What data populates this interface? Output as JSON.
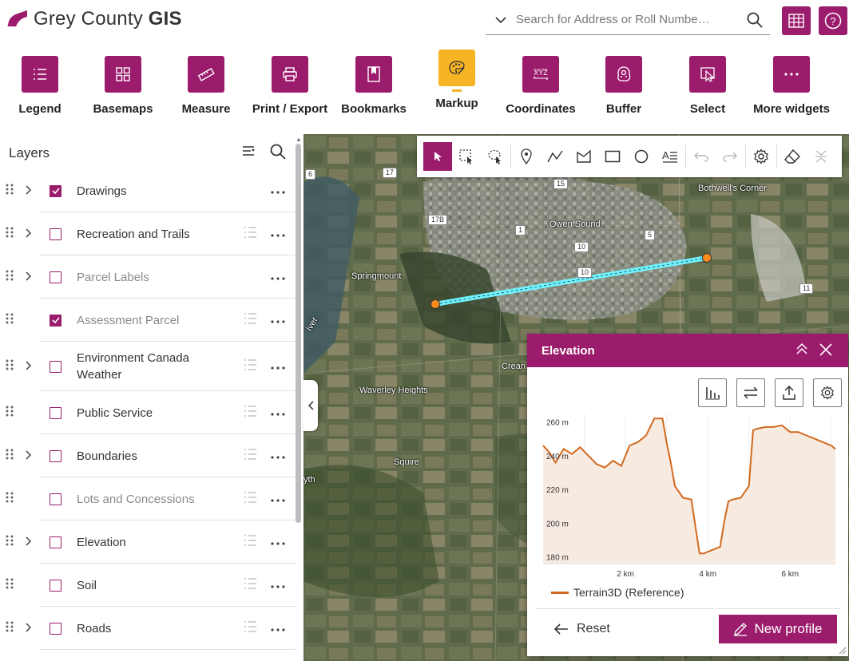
{
  "header": {
    "title_regular": "Grey County ",
    "title_bold": "GIS",
    "search_placeholder": "Search for Address or Roll Numbe…",
    "brand_color": "#9b1c6c"
  },
  "widgets": [
    {
      "label": "Legend",
      "icon": "legend-icon"
    },
    {
      "label": "Basemaps",
      "icon": "basemaps-icon"
    },
    {
      "label": "Measure",
      "icon": "ruler-icon"
    },
    {
      "label": "Print / Export",
      "icon": "printer-icon"
    },
    {
      "label": "Bookmarks",
      "icon": "bookmark-icon"
    },
    {
      "label": "Markup",
      "icon": "palette-icon",
      "active": true
    },
    {
      "label": "Coordinates",
      "icon": "xyz-icon"
    },
    {
      "label": "Buffer",
      "icon": "buffer-icon"
    },
    {
      "label": "Select",
      "icon": "select-icon"
    },
    {
      "label": "More widgets",
      "icon": "more-icon"
    }
  ],
  "layers": {
    "title": "Layers",
    "items": [
      {
        "label": "Drawings",
        "checked": true,
        "expandable": true,
        "dim": false,
        "legend": false
      },
      {
        "label": "Recreation and Trails",
        "checked": false,
        "expandable": true,
        "dim": false,
        "legend": true
      },
      {
        "label": "Parcel Labels",
        "checked": false,
        "expandable": true,
        "dim": true,
        "legend": false
      },
      {
        "label": "Assessment Parcel",
        "checked": true,
        "expandable": false,
        "dim": true,
        "legend": true
      },
      {
        "label": "Environment Canada Weather",
        "checked": false,
        "expandable": true,
        "dim": false,
        "legend": true
      },
      {
        "label": "Public Service",
        "checked": false,
        "expandable": false,
        "dim": false,
        "legend": true
      },
      {
        "label": "Boundaries",
        "checked": false,
        "expandable": true,
        "dim": false,
        "legend": true
      },
      {
        "label": "Lots and Concessions",
        "checked": false,
        "expandable": false,
        "dim": true,
        "legend": true
      },
      {
        "label": "Elevation",
        "checked": false,
        "expandable": true,
        "dim": false,
        "legend": true
      },
      {
        "label": "Soil",
        "checked": false,
        "expandable": false,
        "dim": false,
        "legend": true
      },
      {
        "label": "Roads",
        "checked": false,
        "expandable": true,
        "dim": false,
        "legend": true
      }
    ]
  },
  "map_labels": {
    "owen_sound": "Owen Sound",
    "springmount": "Springmount",
    "bothwells_corner": "Bothwell's Corner",
    "waverley_heights": "Waverley Heights",
    "squire": "Squire",
    "crean": "Crean",
    "river": "iver",
    "yth": "yth"
  },
  "road_shields": [
    "6",
    "17",
    "15",
    "17B",
    "1",
    "5",
    "10",
    "10",
    "11"
  ],
  "markup_tools": [
    "select-icon",
    "rectangle-select-icon",
    "lasso-select-icon",
    "point-icon",
    "polyline-icon",
    "polygon-icon",
    "rectangle-icon",
    "circle-icon",
    "text-icon",
    "undo-icon",
    "redo-icon",
    "settings-icon",
    "eraser-icon",
    "collapse-icon"
  ],
  "elevation": {
    "title": "Elevation",
    "reset_label": "Reset",
    "new_profile_label": "New profile",
    "legend_label": "Terrain3D (Reference)"
  },
  "chart_data": {
    "type": "area",
    "title": "",
    "xlabel": "",
    "ylabel": "",
    "x_ticks": [
      "2 km",
      "4 km",
      "6 km"
    ],
    "y_ticks": [
      "180 m",
      "200 m",
      "220 m",
      "240 m",
      "260 m"
    ],
    "xlim": [
      0,
      7.1
    ],
    "ylim": [
      176,
      265
    ],
    "series": [
      {
        "name": "Terrain3D (Reference)",
        "color": "#d2691e",
        "x": [
          0,
          0.15,
          0.3,
          0.5,
          0.7,
          0.9,
          1.1,
          1.3,
          1.5,
          1.7,
          1.9,
          2.1,
          2.3,
          2.5,
          2.7,
          2.9,
          3.0,
          3.1,
          3.2,
          3.4,
          3.6,
          3.7,
          3.8,
          3.9,
          4.1,
          4.3,
          4.4,
          4.5,
          4.6,
          4.8,
          5.0,
          5.1,
          5.2,
          5.4,
          5.6,
          5.8,
          6.0,
          6.2,
          6.4,
          6.6,
          6.8,
          7.0,
          7.1
        ],
        "values": [
          246,
          242,
          236,
          244,
          241,
          245,
          240,
          235,
          233,
          237,
          234,
          246,
          248,
          252,
          262,
          262,
          248,
          236,
          222,
          215,
          214,
          198,
          182,
          182,
          184,
          186,
          201,
          213,
          214,
          215,
          222,
          255,
          256,
          257,
          257,
          258,
          254,
          254,
          252,
          250,
          248,
          246,
          244
        ]
      }
    ]
  }
}
